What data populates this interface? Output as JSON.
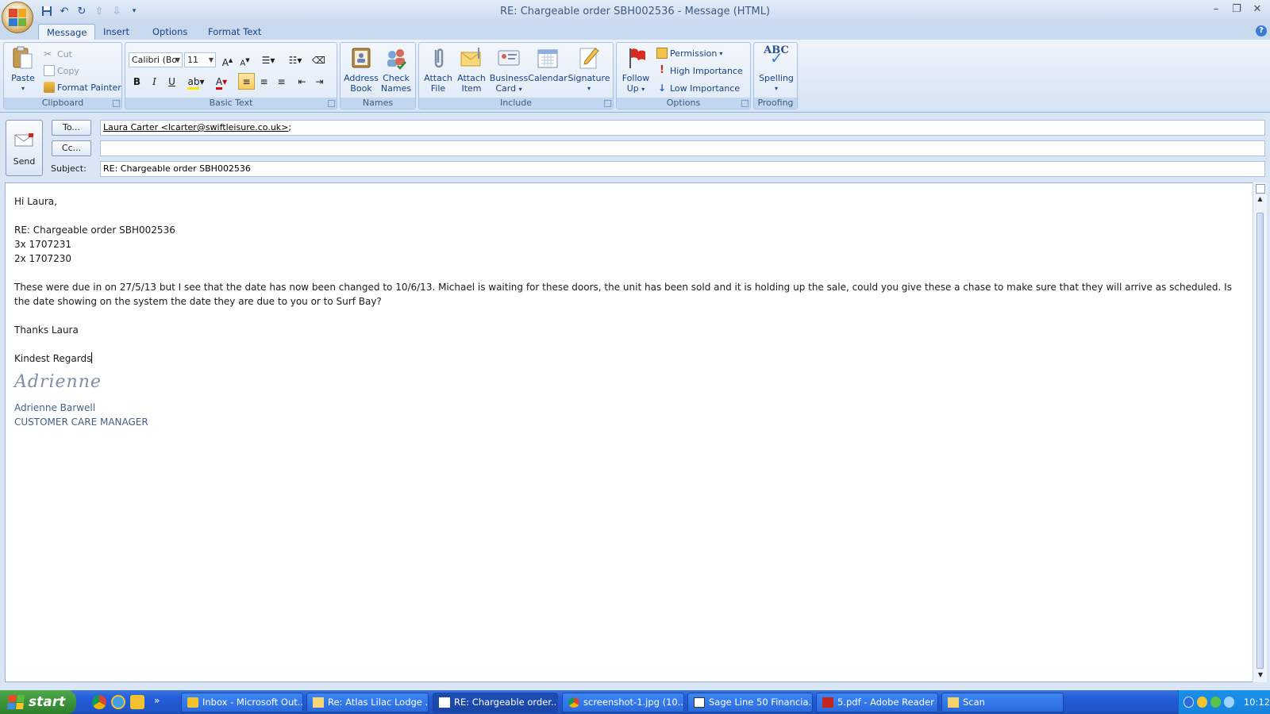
{
  "window": {
    "title": "RE: Chargeable order SBH002536 - Message (HTML)"
  },
  "tabs": [
    {
      "label": "Message",
      "active": true
    },
    {
      "label": "Insert"
    },
    {
      "label": "Options"
    },
    {
      "label": "Format Text"
    }
  ],
  "ribbon": {
    "clipboard": {
      "label": "Clipboard",
      "paste": "Paste",
      "cut": "Cut",
      "copy": "Copy",
      "format_painter": "Format Painter"
    },
    "basic_text": {
      "label": "Basic Text",
      "font": "Calibri (Bo",
      "size": "11"
    },
    "names": {
      "label": "Names",
      "address_book_1": "Address",
      "address_book_2": "Book",
      "check_names_1": "Check",
      "check_names_2": "Names"
    },
    "include": {
      "label": "Include",
      "attach_file_1": "Attach",
      "attach_file_2": "File",
      "attach_item_1": "Attach",
      "attach_item_2": "Item",
      "business_card_1": "Business",
      "business_card_2": "Card",
      "calendar": "Calendar",
      "signature": "Signature"
    },
    "options": {
      "label": "Options",
      "follow_up_1": "Follow",
      "follow_up_2": "Up",
      "permission": "Permission",
      "high_importance": "High Importance",
      "low_importance": "Low Importance"
    },
    "proofing": {
      "label": "Proofing",
      "spelling_icon_text": "ABC",
      "spelling": "Spelling"
    }
  },
  "header": {
    "send": "Send",
    "to_button": "To...",
    "cc_button": "Cc...",
    "subject_label": "Subject:",
    "to_value": "Laura Carter <lcarter@swiftleisure.co.uk>",
    "to_separator": ";",
    "cc_value": "",
    "subject_value": "RE: Chargeable order SBH002536"
  },
  "body": {
    "greeting": "Hi Laura,",
    "line_order": "RE: Chargeable order SBH002536",
    "line_item1": "3x  1707231",
    "line_item2": "2x 1707230",
    "paragraph": "These were due in on 27/5/13 but I see that the date has now been changed to 10/6/13.  Michael is waiting for these doors, the unit has been sold and it is holding up the sale,  could you give these a chase to make sure that they will arrive as scheduled.  Is the date showing on the system the date they are due to you or to Surf Bay?",
    "thanks": "Thanks Laura",
    "regards": "Kindest Regards",
    "signature_script": "Adrienne",
    "sig_name": "Adrienne Barwell",
    "sig_title": "CUSTOMER CARE MANAGER"
  },
  "taskbar": {
    "start": "start",
    "items": [
      {
        "label": "Inbox - Microsoft Out..."
      },
      {
        "label": "Re: Atlas Lilac Lodge ..."
      },
      {
        "label": "RE: Chargeable order...",
        "active": true
      },
      {
        "label": "screenshot-1.jpg (10..."
      },
      {
        "label": "Sage Line 50 Financia..."
      },
      {
        "label": "5.pdf - Adobe Reader"
      },
      {
        "label": "Scan"
      }
    ],
    "clock": "10:12"
  },
  "colors": {
    "accent": "#15428b",
    "ribbon_bg": "#dbe6f4",
    "taskbar": "#245edb",
    "start": "#3c943a"
  }
}
